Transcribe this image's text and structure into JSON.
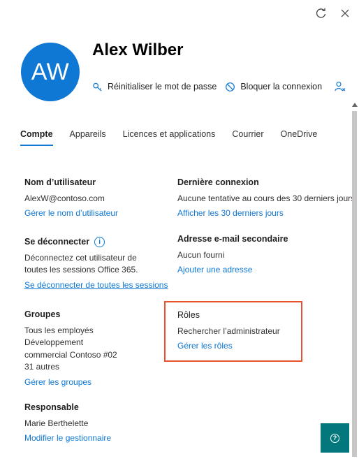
{
  "user": {
    "initials": "AW",
    "name": "Alex Wilber"
  },
  "actions": {
    "reset_password": "Réinitialiser le mot de passe",
    "block_signin": "Bloquer la connexion",
    "delete_user_icon": "person-remove-icon"
  },
  "tabs": [
    {
      "label": "Compte",
      "active": true
    },
    {
      "label": "Appareils"
    },
    {
      "label": "Licences et applications"
    },
    {
      "label": "Courrier"
    },
    {
      "label": "OneDrive"
    }
  ],
  "username": {
    "heading": "Nom d’utilisateur",
    "value": "AlexW@contoso.com",
    "link": "Gérer le nom d’utilisateur"
  },
  "last_signin": {
    "heading": "Dernière connexion",
    "value": "Aucune tentative au cours des 30 derniers jours",
    "link": "Afficher les 30 derniers jours"
  },
  "signout": {
    "heading": "Se déconnecter",
    "text_line1": "Déconnectez cet utilisateur de",
    "text_line2": "toutes les sessions Office 365.",
    "link": "Se déconnecter de toutes les sessions"
  },
  "alt_email": {
    "heading": "Adresse e-mail secondaire",
    "value": "Aucun fourni",
    "link": "Ajouter une adresse"
  },
  "groups": {
    "heading": "Groupes",
    "items": [
      "Tous les employés",
      "Développement",
      "commercial Contoso #02",
      "31 autres"
    ],
    "link": "Gérer les groupes"
  },
  "roles": {
    "heading": "Rôles",
    "value": "Rechercher l’administrateur",
    "link": "Gérer les rôles",
    "highlight_color": "#e8522e"
  },
  "manager": {
    "heading": "Responsable",
    "value": "Marie Berthelette",
    "link": "Modifier le gestionnaire"
  },
  "colors": {
    "accent": "#0f78d4",
    "help_button": "#03787c"
  }
}
